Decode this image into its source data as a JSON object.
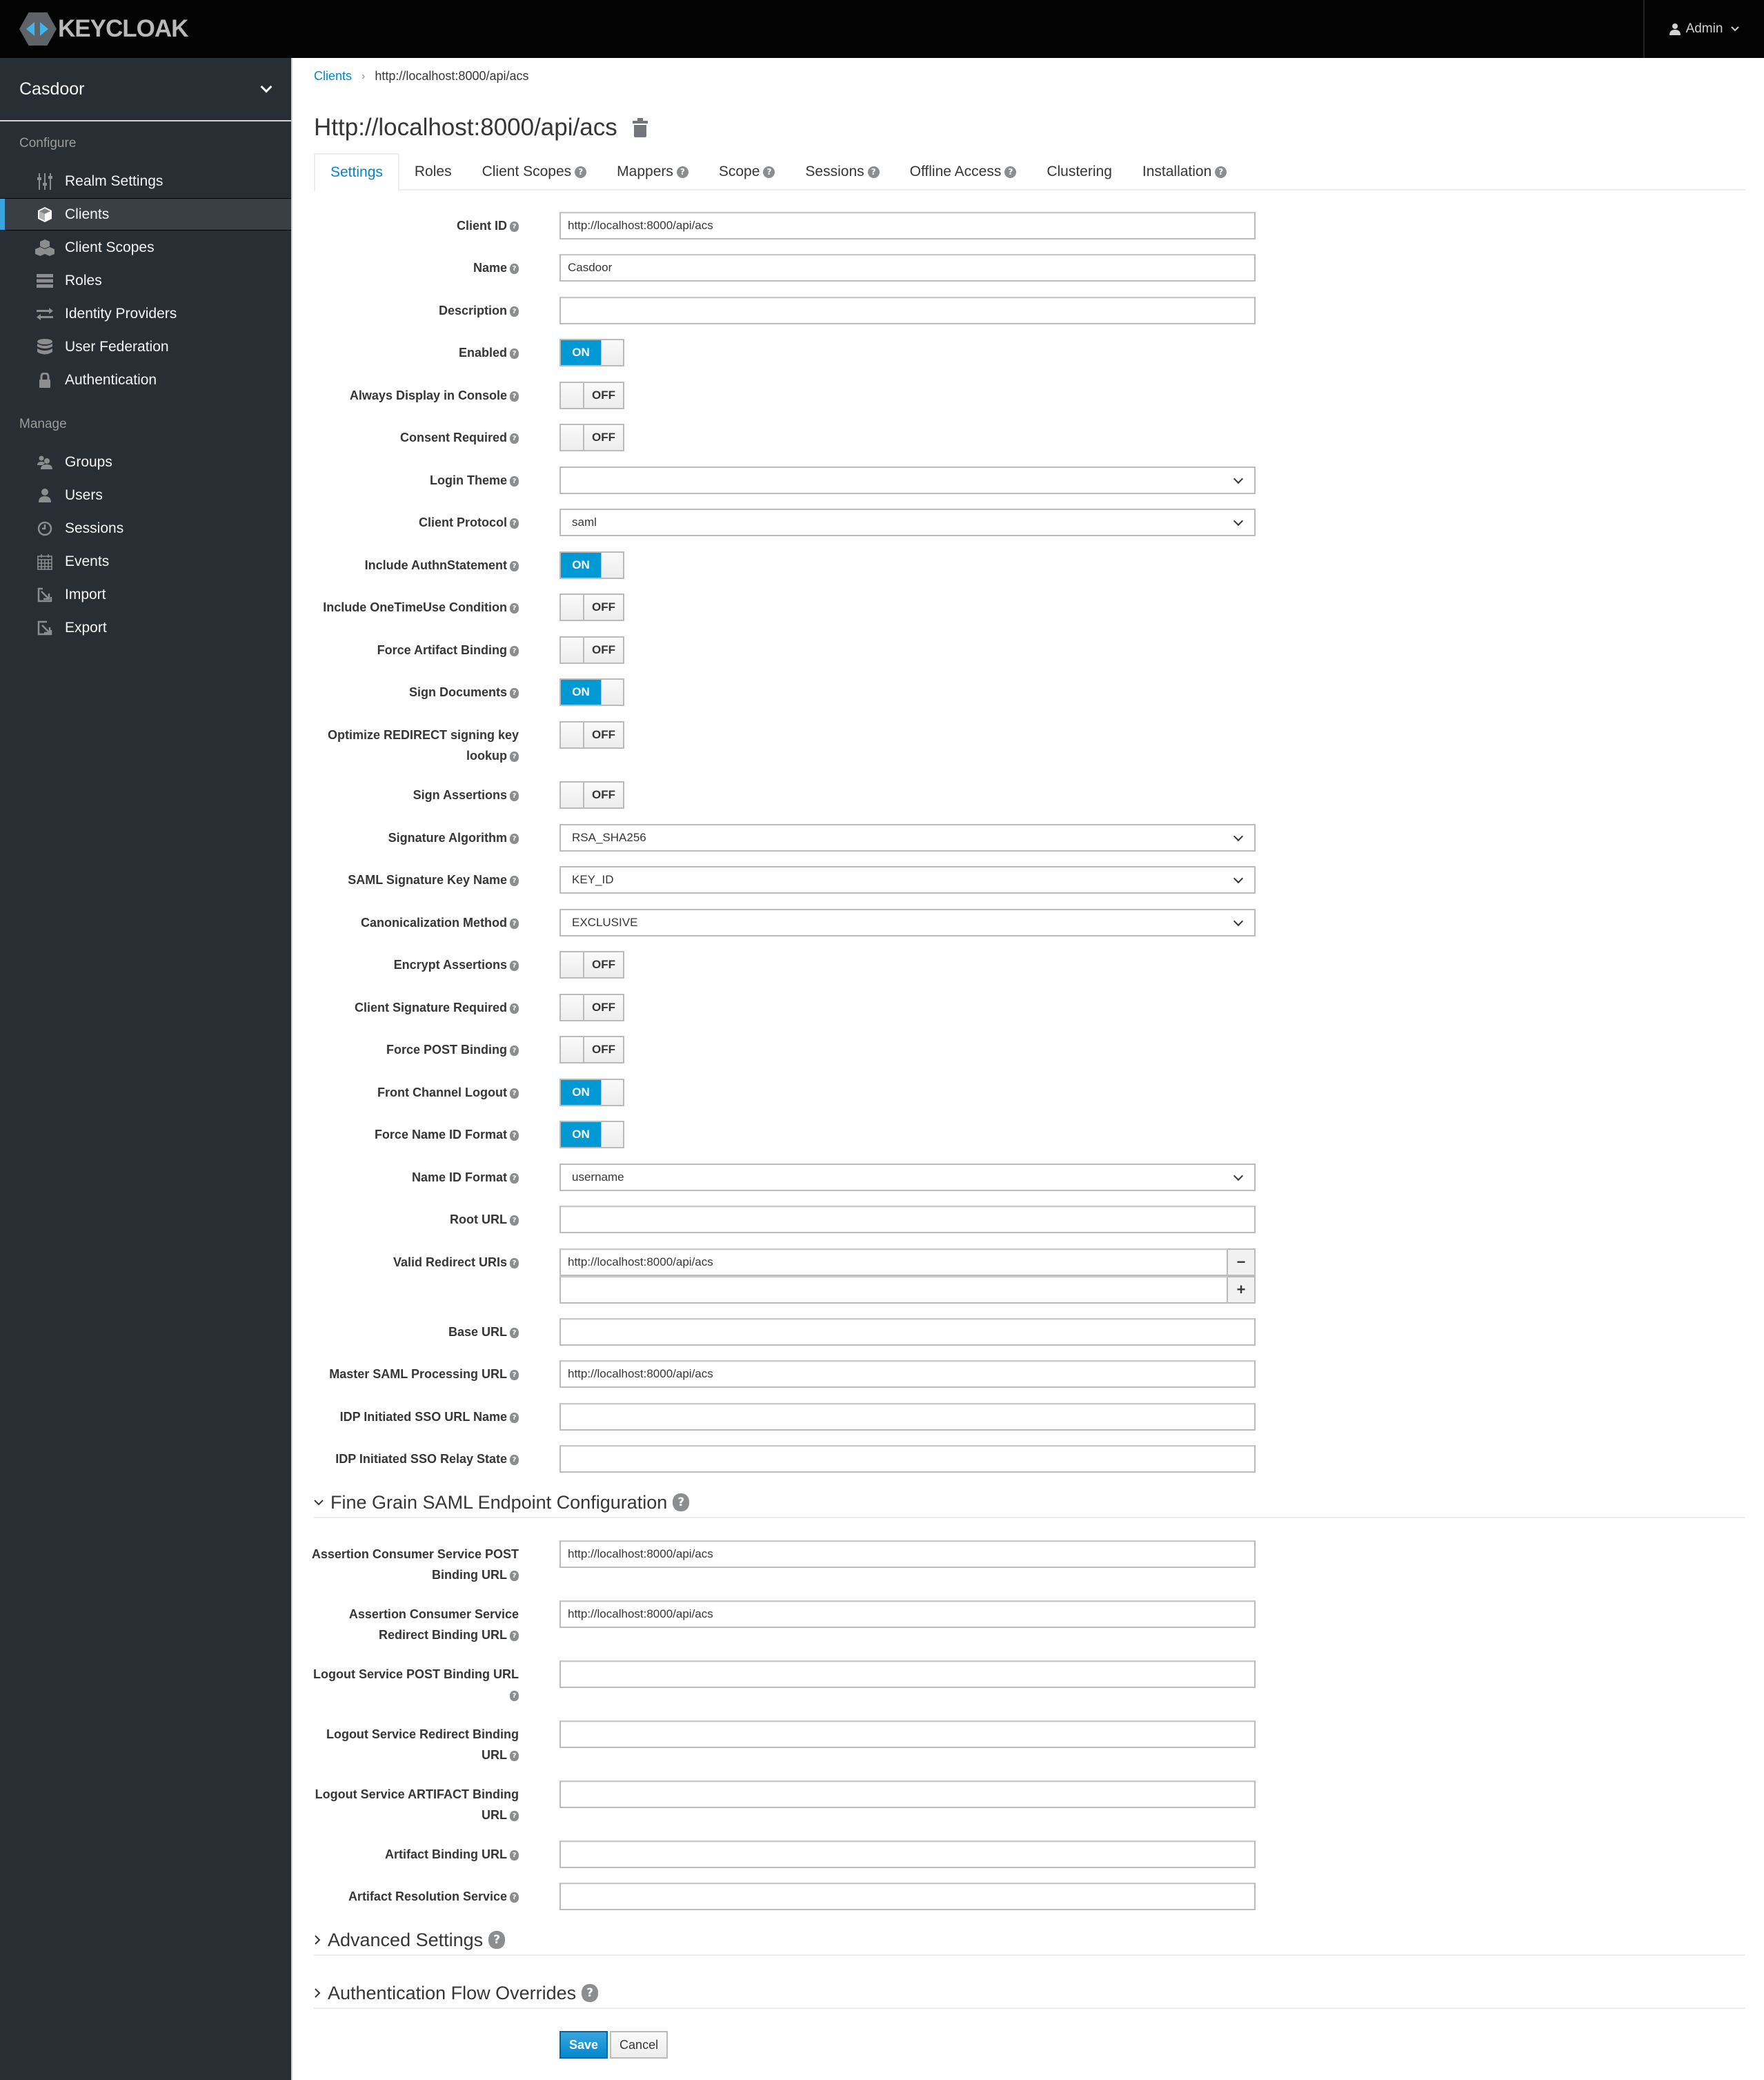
{
  "header": {
    "logo_text": "KEYCLOAK",
    "user_label": "Admin"
  },
  "sidebar": {
    "realm": "Casdoor",
    "configure_label": "Configure",
    "manage_label": "Manage",
    "configure_items": [
      {
        "label": "Realm Settings",
        "icon": "sliders-icon"
      },
      {
        "label": "Clients",
        "icon": "cube-icon",
        "active": true
      },
      {
        "label": "Client Scopes",
        "icon": "cubes-icon"
      },
      {
        "label": "Roles",
        "icon": "list-icon"
      },
      {
        "label": "Identity Providers",
        "icon": "exchange-icon"
      },
      {
        "label": "User Federation",
        "icon": "database-icon"
      },
      {
        "label": "Authentication",
        "icon": "lock-icon"
      }
    ],
    "manage_items": [
      {
        "label": "Groups",
        "icon": "users-icon"
      },
      {
        "label": "Users",
        "icon": "user-icon"
      },
      {
        "label": "Sessions",
        "icon": "clock-icon"
      },
      {
        "label": "Events",
        "icon": "calendar-icon"
      },
      {
        "label": "Import",
        "icon": "import-icon"
      },
      {
        "label": "Export",
        "icon": "export-icon"
      }
    ]
  },
  "breadcrumb": {
    "parent": "Clients",
    "current": "http://localhost:8000/api/acs"
  },
  "page_title": "Http://localhost:8000/api/acs",
  "tabs": [
    {
      "label": "Settings",
      "active": true,
      "help": false
    },
    {
      "label": "Roles",
      "help": false
    },
    {
      "label": "Client Scopes",
      "help": true
    },
    {
      "label": "Mappers",
      "help": true
    },
    {
      "label": "Scope",
      "help": true
    },
    {
      "label": "Sessions",
      "help": true
    },
    {
      "label": "Offline Access",
      "help": true
    },
    {
      "label": "Clustering",
      "help": false
    },
    {
      "label": "Installation",
      "help": true
    }
  ],
  "form": {
    "client_id": {
      "label": "Client ID",
      "value": "http://localhost:8000/api/acs"
    },
    "name": {
      "label": "Name",
      "value": "Casdoor"
    },
    "description": {
      "label": "Description",
      "value": ""
    },
    "enabled": {
      "label": "Enabled",
      "state": "ON"
    },
    "always_display": {
      "label": "Always Display in Console",
      "state": "OFF"
    },
    "consent_required": {
      "label": "Consent Required",
      "state": "OFF"
    },
    "login_theme": {
      "label": "Login Theme",
      "value": ""
    },
    "client_protocol": {
      "label": "Client Protocol",
      "value": "saml"
    },
    "include_authn": {
      "label": "Include AuthnStatement",
      "state": "ON"
    },
    "include_onetimeuse": {
      "label": "Include OneTimeUse Condition",
      "state": "OFF"
    },
    "force_artifact": {
      "label": "Force Artifact Binding",
      "state": "OFF"
    },
    "sign_documents": {
      "label": "Sign Documents",
      "state": "ON"
    },
    "optimize_redirect": {
      "label": "Optimize REDIRECT signing key lookup",
      "state": "OFF"
    },
    "sign_assertions": {
      "label": "Sign Assertions",
      "state": "OFF"
    },
    "signature_algorithm": {
      "label": "Signature Algorithm",
      "value": "RSA_SHA256"
    },
    "saml_sig_key_name": {
      "label": "SAML Signature Key Name",
      "value": "KEY_ID"
    },
    "canonicalization": {
      "label": "Canonicalization Method",
      "value": "EXCLUSIVE"
    },
    "encrypt_assertions": {
      "label": "Encrypt Assertions",
      "state": "OFF"
    },
    "client_sig_required": {
      "label": "Client Signature Required",
      "state": "OFF"
    },
    "force_post": {
      "label": "Force POST Binding",
      "state": "OFF"
    },
    "front_channel_logout": {
      "label": "Front Channel Logout",
      "state": "ON"
    },
    "force_name_id": {
      "label": "Force Name ID Format",
      "state": "ON"
    },
    "name_id_format": {
      "label": "Name ID Format",
      "value": "username"
    },
    "root_url": {
      "label": "Root URL",
      "value": ""
    },
    "valid_redirect_uris": {
      "label": "Valid Redirect URIs",
      "values": [
        "http://localhost:8000/api/acs",
        ""
      ],
      "remove_symbol": "−",
      "add_symbol": "+"
    },
    "base_url": {
      "label": "Base URL",
      "value": ""
    },
    "master_saml_url": {
      "label": "Master SAML Processing URL",
      "value": "http://localhost:8000/api/acs"
    },
    "idp_sso_url_name": {
      "label": "IDP Initiated SSO URL Name",
      "value": ""
    },
    "idp_sso_relay": {
      "label": "IDP Initiated SSO Relay State",
      "value": ""
    }
  },
  "fine_grain": {
    "title": "Fine Grain SAML Endpoint Configuration",
    "acs_post": {
      "label": "Assertion Consumer Service POST Binding URL",
      "value": "http://localhost:8000/api/acs"
    },
    "acs_redirect": {
      "label": "Assertion Consumer Service Redirect Binding URL",
      "value": "http://localhost:8000/api/acs"
    },
    "logout_post": {
      "label": "Logout Service POST Binding URL",
      "value": ""
    },
    "logout_redirect": {
      "label": "Logout Service Redirect Binding URL",
      "value": ""
    },
    "logout_artifact": {
      "label": "Logout Service ARTIFACT Binding URL",
      "value": ""
    },
    "artifact_binding": {
      "label": "Artifact Binding URL",
      "value": ""
    },
    "artifact_resolution": {
      "label": "Artifact Resolution Service",
      "value": ""
    }
  },
  "advanced": {
    "title": "Advanced Settings"
  },
  "auth_flow": {
    "title": "Authentication Flow Overrides"
  },
  "buttons": {
    "save": "Save",
    "cancel": "Cancel"
  },
  "help_glyph": "?",
  "colors": {
    "accent": "#0088ce",
    "switch_on": "#0099d3",
    "sidebar_bg": "#292e34",
    "topbar_bg": "#030303"
  }
}
